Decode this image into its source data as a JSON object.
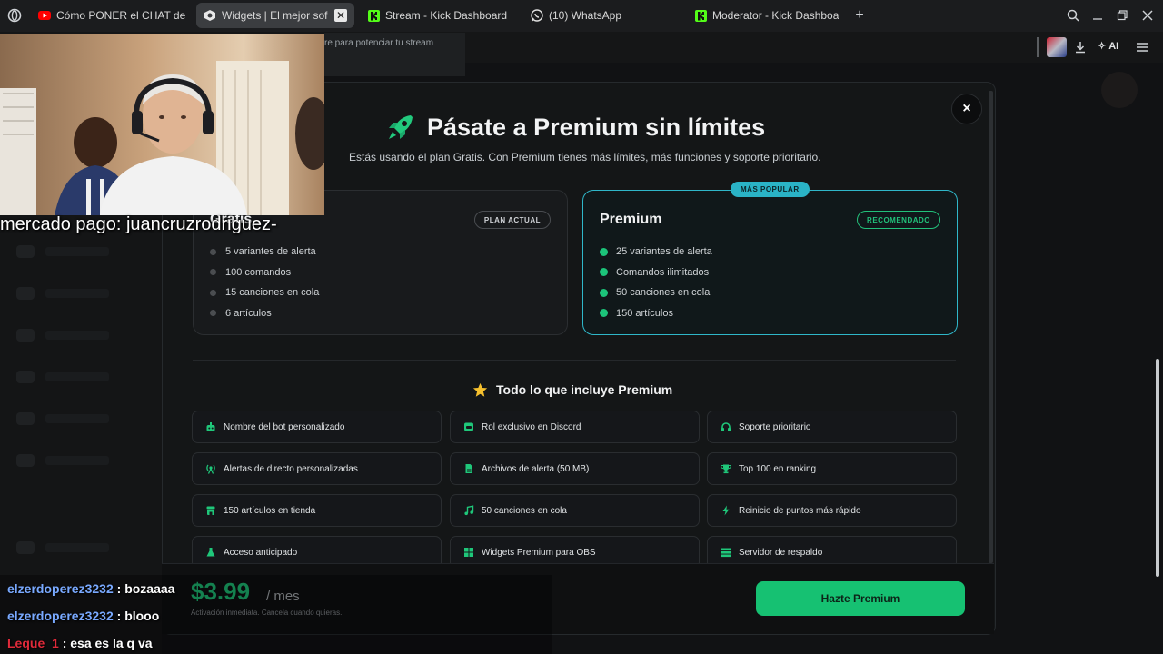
{
  "tabs": [
    {
      "label": "Cómo PONER el CHAT de",
      "icon": "youtube-icon"
    },
    {
      "label": "Widgets | El mejor sof",
      "icon": "site-icon",
      "active": true
    },
    {
      "label": "Stream - Kick Dashboard",
      "icon": "kick-icon"
    },
    {
      "label": "(10) WhatsApp",
      "icon": "whatsapp-icon"
    },
    {
      "label": "Moderator - Kick Dashboa",
      "icon": "kick-icon"
    }
  ],
  "toolbar": {
    "ai_label": "AI"
  },
  "tooltip": "re para potenciar tu stream",
  "modal": {
    "title": "Pásate a Premium sin límites",
    "subtitle": "Estás usando el plan Gratis. Con Premium tienes más límites, más funciones y soporte prioritario.",
    "close": "×",
    "popular_badge": "MÁS POPULAR",
    "free_plan": {
      "name": "Gratis",
      "badge": "PLAN ACTUAL",
      "features": [
        "5 variantes de alerta",
        "100 comandos",
        "15 canciones en cola",
        "6 artículos"
      ]
    },
    "premium_plan": {
      "name": "Premium",
      "badge": "RECOMENDADO",
      "features": [
        "25 variantes de alerta",
        "Comandos ilimitados",
        "50 canciones en cola",
        "150 artículos"
      ]
    },
    "features_title": "Todo lo que incluye Premium",
    "features": [
      {
        "label": "Nombre del bot personalizado",
        "icon": "bot-icon"
      },
      {
        "label": "Rol exclusivo en Discord",
        "icon": "discord-icon"
      },
      {
        "label": "Soporte prioritario",
        "icon": "headset-icon"
      },
      {
        "label": "Alertas de directo personalizadas",
        "icon": "broadcast-icon"
      },
      {
        "label": "Archivos de alerta (50 MB)",
        "icon": "file-icon"
      },
      {
        "label": "Top 100 en ranking",
        "icon": "trophy-icon"
      },
      {
        "label": "150 artículos en tienda",
        "icon": "store-icon"
      },
      {
        "label": "50 canciones en cola",
        "icon": "music-icon"
      },
      {
        "label": "Reinicio de puntos más rápido",
        "icon": "bolt-icon"
      },
      {
        "label": "Acceso anticipado",
        "icon": "flask-icon"
      },
      {
        "label": "Widgets Premium para OBS",
        "icon": "grid-icon"
      },
      {
        "label": "Servidor de respaldo",
        "icon": "server-icon"
      }
    ],
    "price": "$3.99",
    "per": "/ mes",
    "activation": "Activación inmediata. Cancela cuando quieras.",
    "cta": "Hazte Premium"
  },
  "overlay": {
    "mercado_pago": "mercado pago: juancruzrodriguez-",
    "chat": [
      {
        "user": "elzerdoperez3232",
        "message": "bozaaaa",
        "color": "#79a9ff"
      },
      {
        "user": "elzerdoperez3232",
        "message": "blooo",
        "color": "#79a9ff"
      },
      {
        "user": "Leque_1",
        "message": "esa es la q va",
        "color": "#e02a3a"
      }
    ]
  },
  "colors": {
    "accent_green": "#16c172",
    "accent_cyan": "#2fb7c9",
    "background": "#111214"
  }
}
